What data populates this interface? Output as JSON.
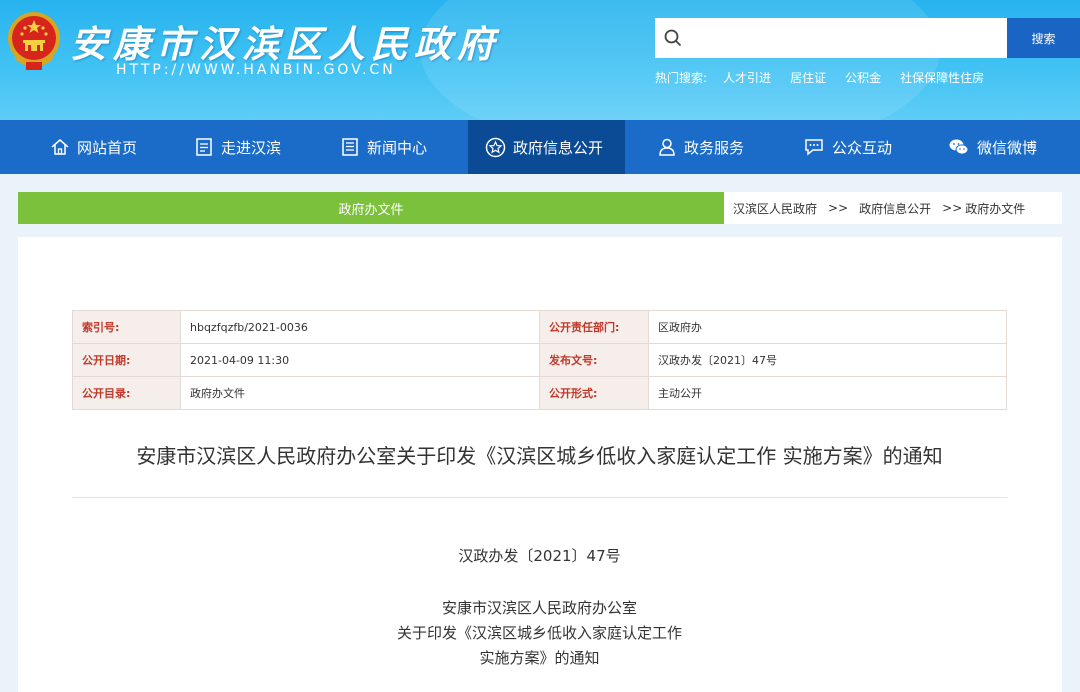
{
  "header": {
    "site_title": "安康市汉滨区人民政府",
    "site_url": "HTTP://WWW.HANBIN.GOV.CN",
    "emblem_icon": "national-emblem-icon",
    "search": {
      "placeholder": "",
      "button_label": "搜索"
    },
    "hot_search": {
      "label": "热门搜索:",
      "links": [
        "人才引进",
        "居住证",
        "公积金",
        "社保保障性住房"
      ]
    }
  },
  "nav": {
    "items": [
      {
        "label": "网站首页",
        "icon": "home-icon"
      },
      {
        "label": "走进汉滨",
        "icon": "document-icon"
      },
      {
        "label": "新闻中心",
        "icon": "news-icon"
      },
      {
        "label": "政府信息公开",
        "icon": "star-icon",
        "active": true
      },
      {
        "label": "政务服务",
        "icon": "user-icon"
      },
      {
        "label": "公众互动",
        "icon": "chat-icon"
      },
      {
        "label": "微信微博",
        "icon": "wechat-icon"
      }
    ]
  },
  "channel": {
    "title": "政府办文件",
    "breadcrumb": [
      "汉滨区人民政府",
      ">>",
      "政府信息公开",
      ">>",
      "政府办文件"
    ]
  },
  "meta": {
    "rows": [
      {
        "k1": "索引号:",
        "v1": "hbqzfqzfb/2021-0036",
        "k2": "公开责任部门:",
        "v2": "区政府办"
      },
      {
        "k1": "公开日期:",
        "v1": "2021-04-09 11:30",
        "k2": "发布文号:",
        "v2": "汉政办发〔2021〕47号"
      },
      {
        "k1": "公开目录:",
        "v1": "政府办文件",
        "k2": "公开形式:",
        "v2": "主动公开"
      }
    ]
  },
  "document": {
    "title": "安康市汉滨区人民政府办公室关于印发《汉滨区城乡低收入家庭认定工作 实施方案》的通知",
    "number": "汉政办发〔2021〕47号",
    "head_lines": [
      "安康市汉滨区人民政府办公室",
      "关于印发《汉滨区城乡低收入家庭认定工作",
      "实施方案》的通知"
    ]
  },
  "colors": {
    "header_blue": "#2fb7f0",
    "nav_blue": "#1a6cc8",
    "nav_active": "#0b4a94",
    "channel_green": "#7cc13b",
    "meta_key_red": "#c0392b"
  }
}
